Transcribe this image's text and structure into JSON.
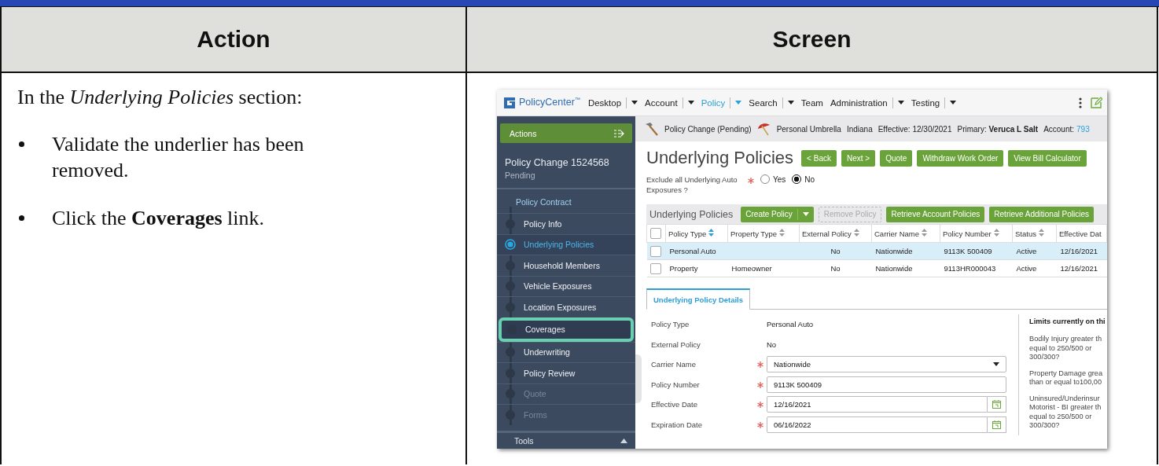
{
  "doc": {
    "headers": [
      "Action",
      "Screen"
    ],
    "action": {
      "intro": "In the *Underlying Policies* section:",
      "bullets": [
        "Validate the underlier has been removed.",
        "Click the **Coverages** link."
      ]
    }
  },
  "screen": {
    "nav": {
      "logo": "PolicyCenter$^{™}$",
      "menus": [
        {
          "label": "Desktop",
          "dropdown": true,
          "selected": false
        },
        {
          "label": "Account",
          "dropdown": true,
          "selected": false
        },
        {
          "label": "Policy",
          "dropdown": true,
          "selected": true
        },
        {
          "label": "Search",
          "dropdown": true,
          "selected": false
        },
        {
          "label": "Team",
          "dropdown": false,
          "selected": false
        },
        {
          "label": "Administration",
          "dropdown": true,
          "selected": false
        },
        {
          "label": "Testing",
          "dropdown": true,
          "selected": false
        }
      ]
    },
    "sidebar": {
      "actions": "Actions",
      "job_title": "Policy Change 1524568",
      "job_status": "Pending",
      "section": "Policy Contract",
      "items": [
        {
          "label": "Policy Info",
          "selected": false,
          "disabled": false,
          "highlighted": false
        },
        {
          "label": "Underlying Policies",
          "selected": true,
          "disabled": false,
          "highlighted": false
        },
        {
          "label": "Household Members",
          "selected": false,
          "disabled": false,
          "highlighted": false
        },
        {
          "label": "Vehicle Exposures",
          "selected": false,
          "disabled": false,
          "highlighted": false
        },
        {
          "label": "Location Exposures",
          "selected": false,
          "disabled": false,
          "highlighted": false
        },
        {
          "label": "Coverages",
          "selected": false,
          "disabled": false,
          "highlighted": true
        },
        {
          "label": "Underwriting",
          "selected": false,
          "disabled": false,
          "highlighted": false
        },
        {
          "label": "Policy Review",
          "selected": false,
          "disabled": false,
          "highlighted": false
        },
        {
          "label": "Quote",
          "selected": false,
          "disabled": true,
          "highlighted": false
        },
        {
          "label": "Forms",
          "selected": false,
          "disabled": true,
          "highlighted": false
        }
      ],
      "tools": {
        "label": "Tools",
        "expanded": true
      }
    },
    "info_bar": [
      {
        "kind": "job",
        "text": "Policy Change (Pending)"
      },
      {
        "kind": "product",
        "text": "Personal Umbrella"
      },
      {
        "kind": "plain",
        "text": "Indiana"
      },
      {
        "kind": "plain",
        "text": "Effective: 12/30/2021"
      },
      {
        "kind": "plain",
        "text": "Primary: **Veruca L Salt**"
      },
      {
        "kind": "plain",
        "text": "Account:"
      },
      {
        "kind": "link",
        "text": "793"
      }
    ],
    "title": "Underlying Policies",
    "buttons": [
      "< Back",
      "Next >",
      "Quote",
      "Withdraw Work Order",
      "View Bill Calculator"
    ],
    "question": {
      "label": "Exclude all Underlying Auto Exposures ?",
      "required": true,
      "options": [
        {
          "label": "Yes",
          "selected": false
        },
        {
          "label": "No",
          "selected": true
        }
      ]
    },
    "panel": {
      "title": "Underlying Policies",
      "all_checked": false,
      "buttons": [
        {
          "label": "Create Policy",
          "kind": "menu",
          "disabled": false
        },
        {
          "label": "Remove Policy",
          "kind": "plain",
          "disabled": true
        },
        {
          "label": "Retrieve Account Policies",
          "kind": "plain",
          "disabled": false
        },
        {
          "label": "Retrieve Additional Policies",
          "kind": "plain",
          "disabled": false
        }
      ],
      "columns": [
        {
          "label": "Policy Type",
          "sortable": true,
          "sorted": true
        },
        {
          "label": "Property Type",
          "sortable": true,
          "sorted": false
        },
        {
          "label": "External Policy",
          "sortable": true,
          "sorted": false
        },
        {
          "label": "Carrier Name",
          "sortable": true,
          "sorted": false
        },
        {
          "label": "Policy Number",
          "sortable": true,
          "sorted": false
        },
        {
          "label": "Status",
          "sortable": true,
          "sorted": false
        },
        {
          "label": "Effective Dat",
          "sortable": false
        }
      ],
      "rows": [
        {
          "selected": true,
          "checked": false,
          "cells": [
            "Personal Auto",
            "",
            "No",
            "Nationwide",
            "9113K 500409",
            "Active",
            "12/16/2021"
          ]
        },
        {
          "selected": false,
          "checked": false,
          "cells": [
            "Property",
            "Homeowner",
            "No",
            "Nationwide",
            "9113HR000043",
            "Active",
            "12/16/2021"
          ]
        }
      ]
    },
    "tabs": [
      {
        "label": "Underlying Policy Details",
        "selected": true
      }
    ],
    "fields": [
      {
        "label": "Policy Type",
        "kind": "static",
        "required": false,
        "value": "Personal Auto"
      },
      {
        "label": "External Policy",
        "kind": "static",
        "required": false,
        "value": "No"
      },
      {
        "label": "Carrier Name",
        "kind": "select",
        "required": true,
        "value": "Nationwide"
      },
      {
        "label": "Policy Number",
        "kind": "text",
        "required": true,
        "value": "9113K 500409"
      },
      {
        "label": "Effective Date",
        "kind": "date",
        "required": true,
        "value": "12/16/2021"
      },
      {
        "label": "Expiration Date",
        "kind": "date",
        "required": true,
        "value": "06/16/2022"
      }
    ],
    "limits": {
      "title": "Limits currently on thi",
      "items": [
        [
          "Bodily Injury greater th",
          "equal to 250/500 or",
          "300/300?"
        ],
        [
          "Property Damage grea",
          "than or equal to100,00"
        ],
        [
          "Uninsured/Underinsur",
          "Motorist - BI greater th",
          "equal to 250/500 or",
          "300/300?"
        ]
      ]
    }
  }
}
